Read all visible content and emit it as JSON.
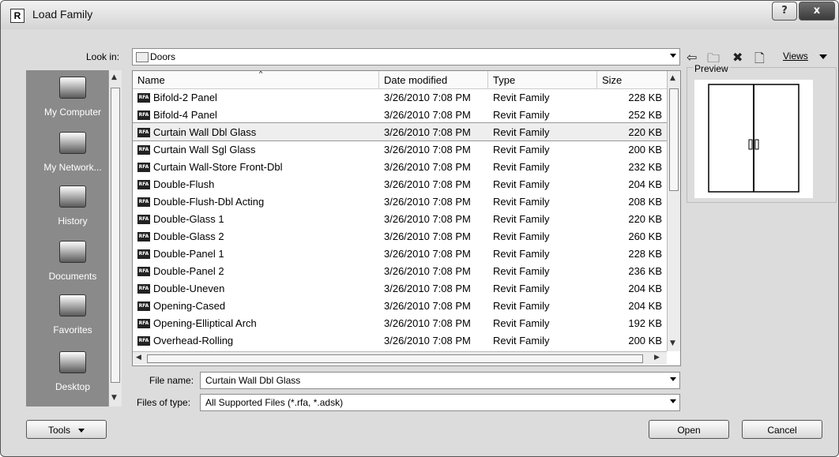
{
  "window": {
    "title": "Load Family",
    "help_glyph": "?",
    "close_glyph": "x"
  },
  "look_in": {
    "label": "Look in:",
    "value": "Doors"
  },
  "toolbar": {
    "views_label": "Views"
  },
  "places": [
    {
      "label": "My Computer",
      "icon": "computer-icon"
    },
    {
      "label": "My Network...",
      "icon": "network-icon"
    },
    {
      "label": "History",
      "icon": "history-icon"
    },
    {
      "label": "Documents",
      "icon": "documents-icon"
    },
    {
      "label": "Favorites",
      "icon": "favorites-icon"
    },
    {
      "label": "Desktop",
      "icon": "desktop-icon"
    }
  ],
  "columns": {
    "name": "Name",
    "date": "Date modified",
    "type": "Type",
    "size": "Size"
  },
  "files": [
    {
      "name": "Bifold-2 Panel",
      "date": "3/26/2010 7:08 PM",
      "type": "Revit Family",
      "size": "228 KB"
    },
    {
      "name": "Bifold-4 Panel",
      "date": "3/26/2010 7:08 PM",
      "type": "Revit Family",
      "size": "252 KB"
    },
    {
      "name": "Curtain Wall Dbl Glass",
      "date": "3/26/2010 7:08 PM",
      "type": "Revit Family",
      "size": "220 KB"
    },
    {
      "name": "Curtain Wall Sgl Glass",
      "date": "3/26/2010 7:08 PM",
      "type": "Revit Family",
      "size": "200 KB"
    },
    {
      "name": "Curtain Wall-Store Front-Dbl",
      "date": "3/26/2010 7:08 PM",
      "type": "Revit Family",
      "size": "232 KB"
    },
    {
      "name": "Double-Flush",
      "date": "3/26/2010 7:08 PM",
      "type": "Revit Family",
      "size": "204 KB"
    },
    {
      "name": "Double-Flush-Dbl Acting",
      "date": "3/26/2010 7:08 PM",
      "type": "Revit Family",
      "size": "208 KB"
    },
    {
      "name": "Double-Glass 1",
      "date": "3/26/2010 7:08 PM",
      "type": "Revit Family",
      "size": "220 KB"
    },
    {
      "name": "Double-Glass 2",
      "date": "3/26/2010 7:08 PM",
      "type": "Revit Family",
      "size": "260 KB"
    },
    {
      "name": "Double-Panel 1",
      "date": "3/26/2010 7:08 PM",
      "type": "Revit Family",
      "size": "228 KB"
    },
    {
      "name": "Double-Panel 2",
      "date": "3/26/2010 7:08 PM",
      "type": "Revit Family",
      "size": "236 KB"
    },
    {
      "name": "Double-Uneven",
      "date": "3/26/2010 7:08 PM",
      "type": "Revit Family",
      "size": "204 KB"
    },
    {
      "name": "Opening-Cased",
      "date": "3/26/2010 7:08 PM",
      "type": "Revit Family",
      "size": "204 KB"
    },
    {
      "name": "Opening-Elliptical Arch",
      "date": "3/26/2010 7:08 PM",
      "type": "Revit Family",
      "size": "192 KB"
    },
    {
      "name": "Overhead-Rolling",
      "date": "3/26/2010 7:08 PM",
      "type": "Revit Family",
      "size": "200 KB"
    }
  ],
  "selected_index": 2,
  "file_icon_text": "RFA",
  "preview": {
    "label": "Preview"
  },
  "file_name": {
    "label": "File name:",
    "value": "Curtain Wall Dbl Glass"
  },
  "file_type": {
    "label": "Files of type:",
    "value": "All Supported Files  (*.rfa,  *.adsk)"
  },
  "buttons": {
    "tools": "Tools",
    "open": "Open",
    "cancel": "Cancel"
  }
}
